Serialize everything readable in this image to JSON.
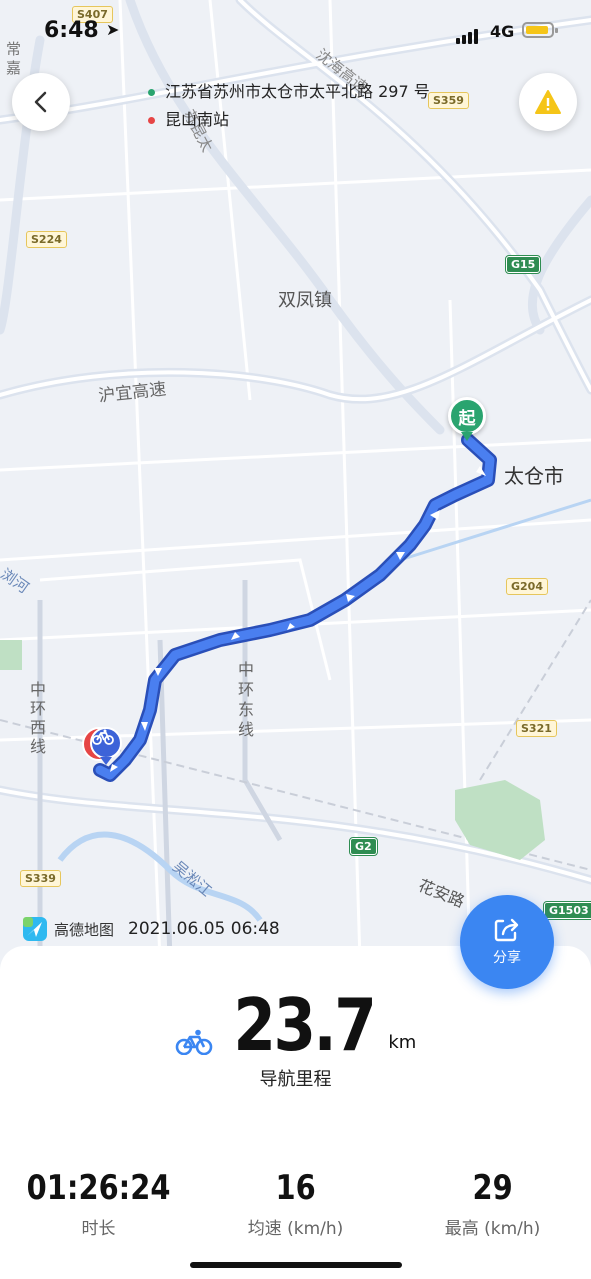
{
  "status": {
    "time": "6:48",
    "network": "4G"
  },
  "route": {
    "origin": "江苏省苏州市太仓市太平北路 297 号",
    "destination": "昆山南站"
  },
  "map_labels": {
    "shuangfeng": "双凤镇",
    "taicang": "太仓市",
    "huyi": "沪宜高速",
    "zhonghuan_east": "中环东线",
    "zhonghuan_west": "中环西线",
    "shenhai": "沈海高速",
    "wusong": "吴淞江",
    "huaan": "花安路",
    "changjia": "常嘉",
    "chanhe": "浏河",
    "start_marker": "起",
    "su_yang": "苏昆太"
  },
  "road_shields": {
    "s407": "S407",
    "s359": "S359",
    "s224": "S224",
    "g15": "G15",
    "g204": "G204",
    "s321": "S321",
    "g2": "G2",
    "s339": "S339",
    "g1503": "G1503"
  },
  "footer": {
    "brand": "高德地图",
    "timestamp": "2021.06.05 06:48",
    "share_label": "分享"
  },
  "summary": {
    "distance": "23.7",
    "distance_unit": "km",
    "distance_label": "导航里程",
    "stats": [
      {
        "value": "01:26:24",
        "label": "时长"
      },
      {
        "value": "16",
        "label": "均速 (km/h)"
      },
      {
        "value": "29",
        "label": "最高 (km/h)"
      }
    ]
  },
  "colors": {
    "route": "#3f6de0",
    "accent": "#3b86f2",
    "start": "#2aa46f",
    "warning": "#f5c518"
  }
}
